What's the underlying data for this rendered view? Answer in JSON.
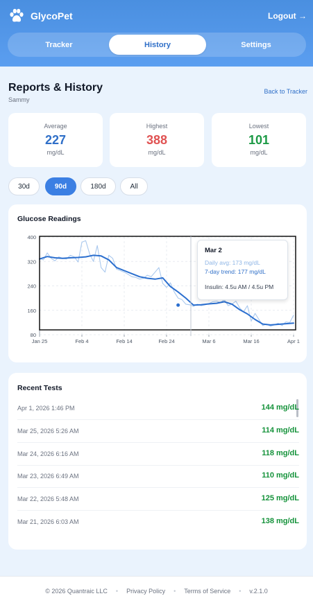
{
  "header": {
    "brand": "GlycoPet",
    "logout_label": "Logout →",
    "tabs": [
      {
        "label": "Tracker",
        "active": false
      },
      {
        "label": "History",
        "active": true
      },
      {
        "label": "Settings",
        "active": false
      }
    ]
  },
  "page": {
    "title": "Reports & History",
    "pet_name": "Sammy",
    "back_label": "Back to Tracker"
  },
  "stats": [
    {
      "label": "Average",
      "value": "227",
      "unit": "mg/dL",
      "color": "#2f6fc8"
    },
    {
      "label": "Highest",
      "value": "388",
      "unit": "mg/dL",
      "color": "#e05252"
    },
    {
      "label": "Lowest",
      "value": "101",
      "unit": "mg/dL",
      "color": "#1d9a46"
    }
  ],
  "ranges": [
    {
      "label": "30d",
      "active": false
    },
    {
      "label": "90d",
      "active": true
    },
    {
      "label": "180d",
      "active": false
    },
    {
      "label": "All",
      "active": false
    }
  ],
  "chart_card": {
    "title": "Glucose Readings"
  },
  "chart_data": {
    "type": "line",
    "title": "Glucose Readings",
    "xlabel": "",
    "ylabel": "",
    "x_ticks": [
      "Jan 25",
      "Feb 4",
      "Feb 14",
      "Feb 24",
      "Mar 6",
      "Mar 16",
      "Apr 1"
    ],
    "y_ticks": [
      80,
      160,
      240,
      320,
      400
    ],
    "ylim": [
      80,
      400
    ],
    "xlim_days": [
      0,
      66
    ],
    "grid": true,
    "series": [
      {
        "name": "Daily avg",
        "color": "#a9c8ee",
        "x": [
          0,
          1,
          2,
          3,
          4,
          5,
          6,
          7,
          8,
          9,
          10,
          11,
          12,
          13,
          14,
          15,
          16,
          17,
          18,
          19,
          20,
          21,
          22,
          23,
          24,
          25,
          26,
          27,
          28,
          29,
          30,
          31,
          32,
          33,
          34,
          35,
          36,
          37,
          38,
          39,
          40,
          41,
          42,
          43,
          44,
          45,
          46,
          47,
          48,
          49,
          50,
          51,
          52,
          53,
          54,
          55,
          56,
          57,
          58,
          59,
          60,
          61,
          62,
          63,
          64,
          65,
          66
        ],
        "values": [
          330,
          325,
          348,
          330,
          322,
          335,
          330,
          328,
          340,
          335,
          318,
          383,
          388,
          345,
          320,
          372,
          300,
          285,
          340,
          330,
          295,
          290,
          285,
          278,
          270,
          268,
          262,
          265,
          275,
          270,
          285,
          300,
          248,
          235,
          250,
          220,
          200,
          195,
          180,
          178,
          173,
          180,
          175,
          178,
          182,
          188,
          190,
          185,
          195,
          175,
          180,
          190,
          168,
          155,
          175,
          125,
          150,
          130,
          110,
          115,
          108,
          112,
          118,
          110,
          122,
          120,
          144
        ]
      },
      {
        "name": "7-day trend",
        "color": "#2b6fcf",
        "x": [
          0,
          2,
          4,
          6,
          8,
          10,
          12,
          14,
          16,
          18,
          20,
          22,
          24,
          26,
          28,
          30,
          32,
          34,
          36,
          38,
          40,
          42,
          44,
          46,
          48,
          50,
          52,
          54,
          56,
          58,
          60,
          62,
          64,
          66
        ],
        "values": [
          328,
          336,
          332,
          330,
          332,
          333,
          335,
          340,
          338,
          325,
          300,
          290,
          280,
          270,
          265,
          262,
          266,
          238,
          220,
          200,
          177,
          178,
          181,
          183,
          188,
          180,
          162,
          148,
          130,
          115,
          112,
          114,
          116,
          118
        ]
      }
    ],
    "tooltip": {
      "date": "Mar 2",
      "daily_avg": "Daily avg: 173 mg/dL",
      "trend": "7-day trend: 177 mg/dL",
      "insulin": "Insulin: 4.5u AM / 4.5u PM"
    }
  },
  "recent_tests": {
    "title": "Recent Tests",
    "items": [
      {
        "date": "Apr 1, 2026 1:46 PM",
        "value": "144 mg/dL"
      },
      {
        "date": "Mar 25, 2026 5:26 AM",
        "value": "114 mg/dL"
      },
      {
        "date": "Mar 24, 2026 6:16 AM",
        "value": "118 mg/dL"
      },
      {
        "date": "Mar 23, 2026 6:49 AM",
        "value": "110 mg/dL"
      },
      {
        "date": "Mar 22, 2026 5:48 AM",
        "value": "125 mg/dL"
      },
      {
        "date": "Mar 21, 2026 6:03 AM",
        "value": "138 mg/dL"
      }
    ]
  },
  "footer": {
    "copyright": "© 2026 Quantraic LLC",
    "privacy": "Privacy Policy",
    "terms": "Terms of Service",
    "version": "v.2.1.0"
  }
}
